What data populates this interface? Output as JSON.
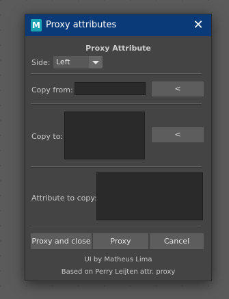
{
  "window": {
    "title": "Proxy attributes",
    "app_icon_letter": "M",
    "close_glyph": "✕"
  },
  "header": "Proxy Attribute",
  "side": {
    "label": "Side:",
    "value": "Left"
  },
  "copy_from": {
    "label": "Copy from:",
    "value": "",
    "button": "<"
  },
  "copy_to": {
    "label": "Copy to:",
    "button": "<"
  },
  "attribute": {
    "label": "Attribute to copy:"
  },
  "buttons": {
    "proxy_and_close": "Proxy and close",
    "proxy": "Proxy",
    "cancel": "Cancel"
  },
  "footer": {
    "line1": "UI by Matheus Lima",
    "line2": "Based on Perry Leijten attr. proxy"
  },
  "colors": {
    "titlebar": "#0b3a78",
    "panel": "#444444",
    "field": "#2a2a2a",
    "button": "#5d5d5d"
  },
  "icons": [
    "maya-app-icon",
    "close-icon",
    "chevron-down-icon"
  ]
}
